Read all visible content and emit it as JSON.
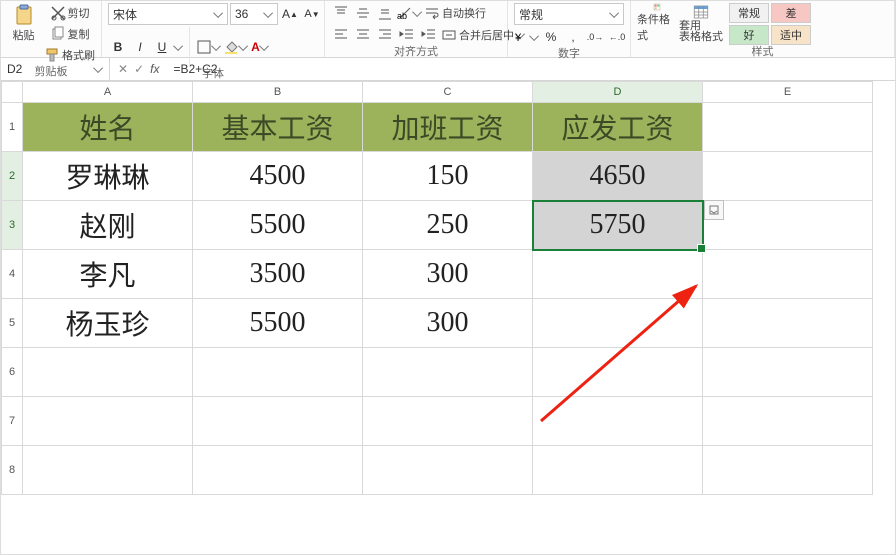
{
  "ribbon": {
    "clipboard": {
      "paste": "粘贴",
      "cut": "剪切",
      "copy": "复制",
      "format_painter": "格式刷",
      "group": "剪贴板"
    },
    "font": {
      "name": "宋体",
      "size": "36",
      "bold": "B",
      "italic": "I",
      "underline": "U",
      "group": "字体"
    },
    "alignment": {
      "wrap": "自动换行",
      "merge": "合并后居中",
      "group": "对齐方式"
    },
    "number": {
      "format": "常规",
      "group": "数字"
    },
    "styles": {
      "cond_fmt": "条件格式",
      "table_fmt": "套用\n表格格式",
      "swatch1": "常规",
      "swatch2": "差",
      "swatch3": "好",
      "swatch4": "适中",
      "group": "样式"
    }
  },
  "namebox": "D2",
  "formula": "=B2+C2",
  "columns": [
    "A",
    "B",
    "C",
    "D",
    "E"
  ],
  "header_row": [
    "姓名",
    "基本工资",
    "加班工资",
    "应发工资"
  ],
  "rows": [
    {
      "n": "2",
      "a": "罗琳琳",
      "b": "4500",
      "c": "150",
      "d": "4650"
    },
    {
      "n": "3",
      "a": "赵刚",
      "b": "5500",
      "c": "250",
      "d": "5750"
    },
    {
      "n": "4",
      "a": "李凡",
      "b": "3500",
      "c": "300",
      "d": ""
    },
    {
      "n": "5",
      "a": "杨玉珍",
      "b": "5500",
      "c": "300",
      "d": ""
    }
  ],
  "empty_rows": [
    "6",
    "7",
    "8"
  ]
}
